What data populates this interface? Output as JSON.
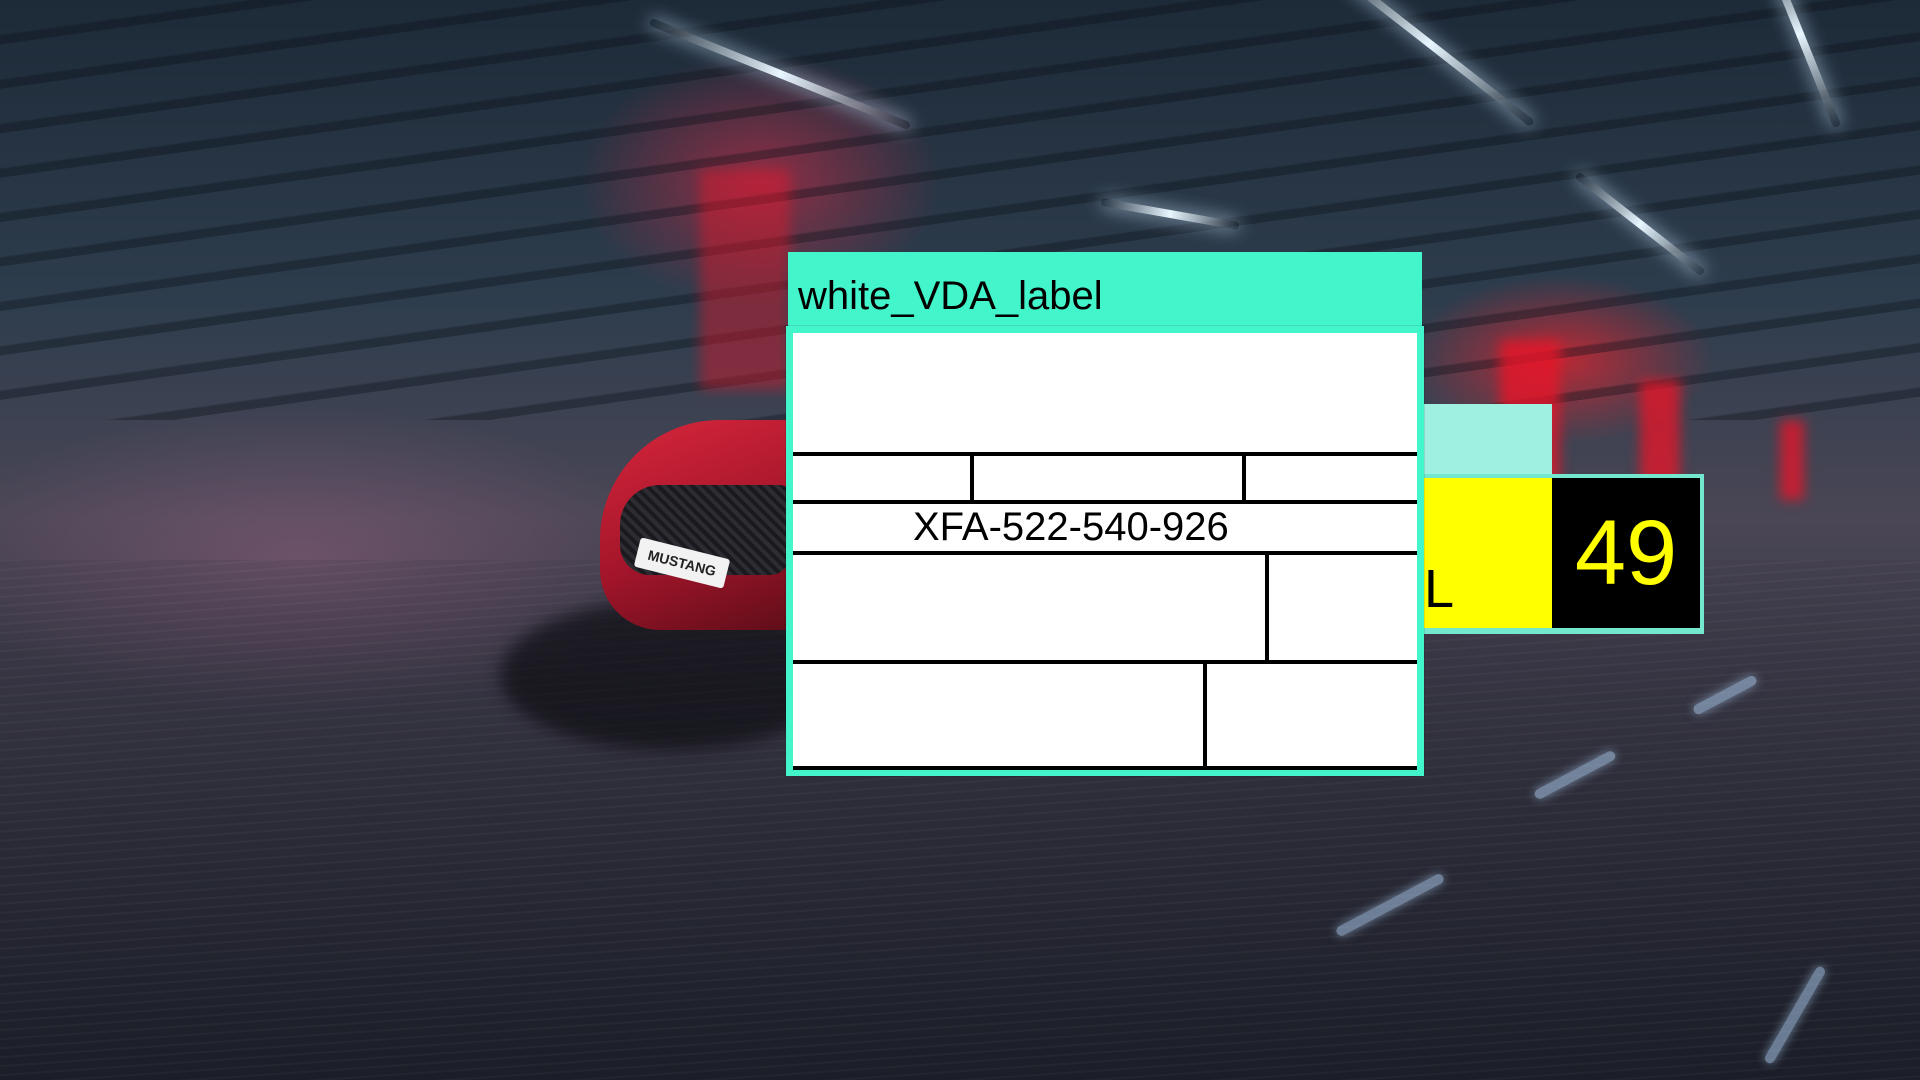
{
  "front_label": {
    "title": "white_VDA_label",
    "code": "XFA-522-540-926"
  },
  "back_label": {
    "partial_text": "L",
    "number": "49"
  },
  "car": {
    "plate": "MUSTANG"
  },
  "colors": {
    "label_accent": "#42f5cb",
    "back_accent": "#74e8cf",
    "back_yellow": "#ffff00",
    "back_black": "#000000"
  }
}
